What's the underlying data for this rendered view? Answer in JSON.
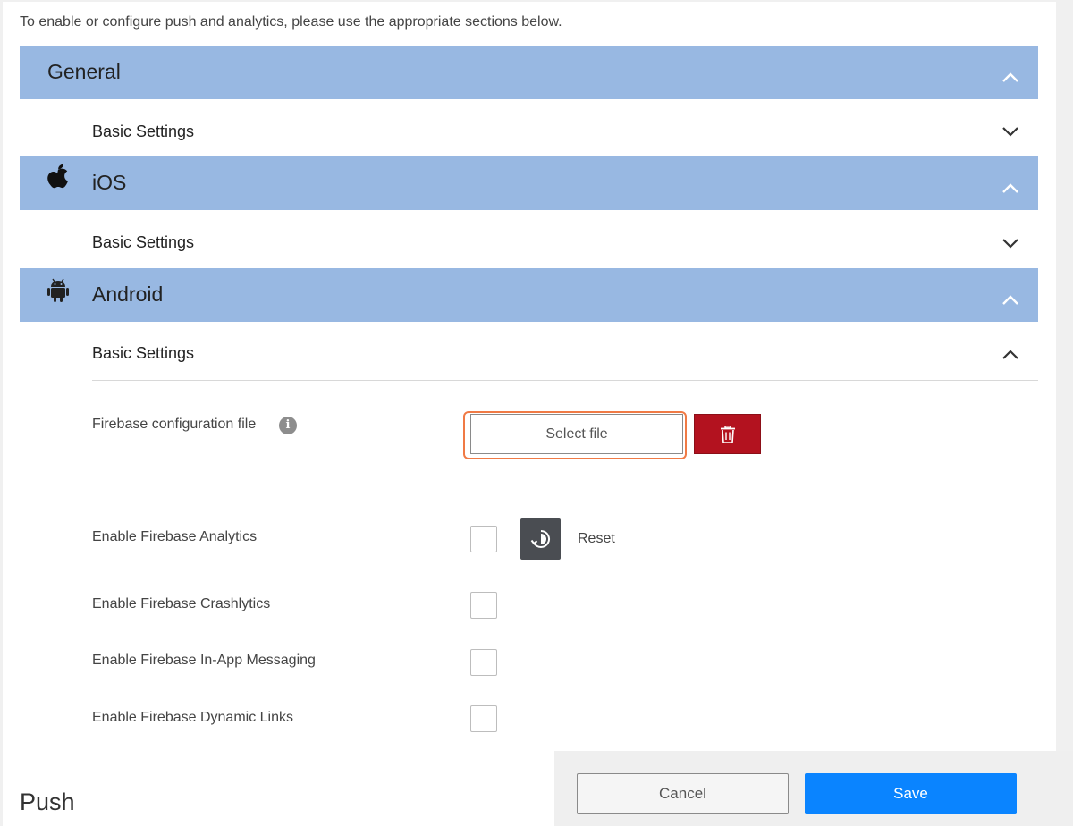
{
  "intro_text": "To enable or configure push and analytics, please use the appropriate sections below.",
  "sections": [
    {
      "title": "General",
      "icon": "",
      "expanded": true,
      "sub": {
        "label": "Basic Settings",
        "expanded": false
      }
    },
    {
      "title": "iOS",
      "icon": "apple-icon",
      "expanded": true,
      "sub": {
        "label": "Basic Settings",
        "expanded": false
      }
    },
    {
      "title": "Android",
      "icon": "android-icon",
      "expanded": true,
      "sub": {
        "label": "Basic Settings",
        "expanded": true
      }
    }
  ],
  "android_settings": {
    "firebase_config_label": "Firebase configuration file",
    "select_file_label": "Select file",
    "analytics_label": "Enable Firebase Analytics",
    "analytics_checked": false,
    "reset_label": "Reset",
    "crashlytics_label": "Enable Firebase Crashlytics",
    "crashlytics_checked": false,
    "inapp_label": "Enable Firebase In-App Messaging",
    "inapp_checked": false,
    "dynamic_links_label": "Enable Firebase Dynamic Links",
    "dynamic_links_checked": false
  },
  "push_heading": "Push",
  "footer": {
    "cancel_label": "Cancel",
    "save_label": "Save"
  },
  "colors": {
    "section_header_bg": "#98b8e2",
    "delete_button": "#b3121f",
    "save_button": "#0a84ff",
    "focus_ring": "#f07a45",
    "reset_button": "#4a4d52"
  }
}
